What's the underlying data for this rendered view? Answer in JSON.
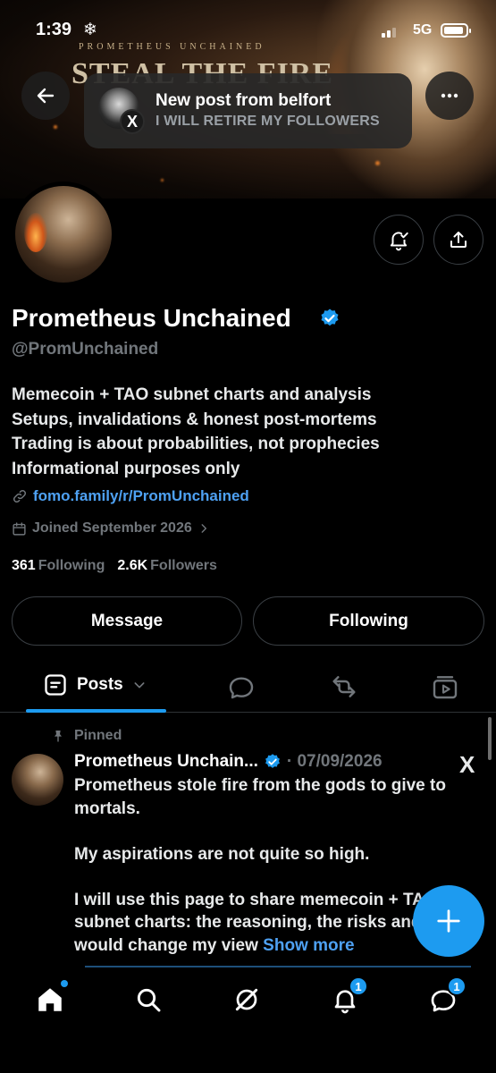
{
  "status_bar": {
    "time": "1:39",
    "network": "5G"
  },
  "banner": {
    "brand_small": "PROMETHEUS UNCHAINED",
    "brand_big": "STEAL THE FIRE"
  },
  "notification": {
    "title": "New post from belfort",
    "subtitle": "I WILL RETIRE MY FOLLOWERS",
    "badge": "X"
  },
  "profile": {
    "display_name": "Prometheus Unchained",
    "handle": "@PromUnchained",
    "bio": [
      "Memecoin + TAO subnet charts and analysis",
      "Setups, invalidations & honest post-mortems",
      "Trading is about probabilities, not prophecies",
      "Informational purposes only"
    ],
    "link": "fomo.family/r/PromUnchained",
    "joined": "Joined September 2026",
    "following_count": "361",
    "following_label": "Following",
    "followers_count": "2.6K",
    "followers_label": "Followers"
  },
  "actions": {
    "message": "Message",
    "following": "Following"
  },
  "tabs": {
    "posts": "Posts"
  },
  "post": {
    "pinned_label": "Pinned",
    "author": "Prometheus Unchain...",
    "meta": "· 07/09/2026",
    "x_mark": "X",
    "paragraphs": [
      "Prometheus stole fire from the gods to give to mortals.",
      "My aspirations are not quite so high."
    ],
    "last_paragraph": "I will use this page to share memecoin + TAO subnet charts: the reasoning, the risks and what would change my view",
    "show_more": "Show more"
  },
  "bottom_nav": {
    "notifications_badge": "1",
    "messages_badge": "1"
  },
  "colors": {
    "accent": "#1d9bf0",
    "link": "#4ea1f3",
    "muted": "#71767b"
  }
}
